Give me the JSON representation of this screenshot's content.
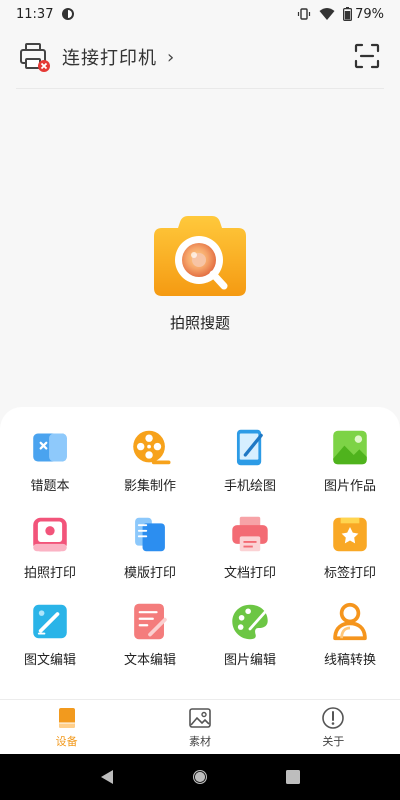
{
  "status_bar": {
    "time": "11:37",
    "battery": "79%"
  },
  "header": {
    "title": "连接打印机",
    "chevron": "›"
  },
  "camera_feature": {
    "label": "拍照搜题"
  },
  "grid": [
    {
      "label": "错题本",
      "icon": "wrong-book-icon"
    },
    {
      "label": "影集制作",
      "icon": "film-reel-icon"
    },
    {
      "label": "手机绘图",
      "icon": "phone-drawing-icon"
    },
    {
      "label": "图片作品",
      "icon": "image-works-icon"
    },
    {
      "label": "拍照打印",
      "icon": "photo-print-icon"
    },
    {
      "label": "模版打印",
      "icon": "template-print-icon"
    },
    {
      "label": "文档打印",
      "icon": "document-print-icon"
    },
    {
      "label": "标签打印",
      "icon": "label-print-icon"
    },
    {
      "label": "图文编辑",
      "icon": "image-text-edit-icon"
    },
    {
      "label": "文本编辑",
      "icon": "text-edit-icon"
    },
    {
      "label": "图片编辑",
      "icon": "image-edit-icon"
    },
    {
      "label": "线稿转换",
      "icon": "line-art-convert-icon"
    }
  ],
  "bottom_nav": [
    {
      "label": "设备",
      "active": true
    },
    {
      "label": "素材",
      "active": false
    },
    {
      "label": "关于",
      "active": false
    }
  ],
  "colors": {
    "accent": "#f29a1e",
    "nav_active": "#f29a1e"
  }
}
